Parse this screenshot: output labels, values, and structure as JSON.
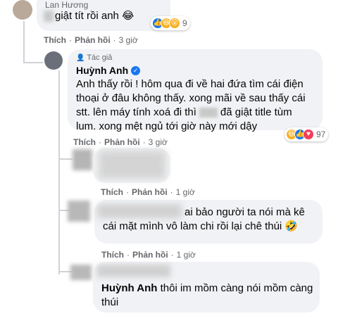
{
  "comment1": {
    "name": "Lan Hương",
    "text": "giật tít rồi anh 😂",
    "reactions": {
      "count": "9"
    },
    "actions": {
      "like": "Thích",
      "reply": "Phản hồi",
      "time": "3 giờ"
    }
  },
  "comment2": {
    "author_badge": "Tác giả",
    "name": "Huỳnh Anh",
    "lines": [
      "Anh thấy rồi ! hôm qua đi về hai đứa tìm cái điện",
      "thoại ở đâu không thấy. xong mãi về sau thấy cái",
      "stt. lên máy tính xoá đi thì",
      "đã giật title tùm",
      "lum. xong mệt ngủ tới giờ này mới dậy"
    ],
    "reactions": {
      "count": "97"
    },
    "actions": {
      "like": "Thích",
      "reply": "Phản hồi",
      "time": "3 giờ"
    }
  },
  "comment3": {
    "actions": {
      "like": "Thích",
      "reply": "Phản hồi",
      "time": "1 giờ"
    }
  },
  "comment4": {
    "line1": "ai bảo người ta nói mà kê",
    "line2": "cái mặt mình vô làm chi rồi lại chê thúi 🤣",
    "actions": {
      "like": "Thích",
      "reply": "Phản hồi",
      "time": "1 giờ"
    }
  },
  "comment5": {
    "mention": "Huỳnh Anh",
    "line1": "thôi im mồm càng nói mồm càng",
    "line2": "thúi"
  },
  "colors": {
    "bubble": "#f0f2f5",
    "meta": "#65676b",
    "verified": "#1877f2"
  }
}
